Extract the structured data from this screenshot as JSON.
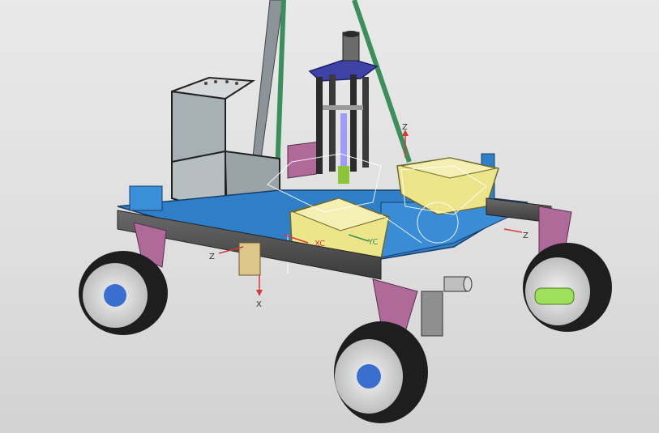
{
  "viewport": {
    "background_top": "#e9e9e9",
    "background_bottom": "#d2d2d2"
  },
  "axes": {
    "z_top": "Z",
    "z_right": "Z",
    "z_left": "Z",
    "x_bottom": "X",
    "xc": "XC",
    "yc": "YC"
  },
  "colors": {
    "chassis_blue": "#2f7fc8",
    "frame_dark": "#4a4a4a",
    "bin_yellow": "#ece58a",
    "panel_gray": "#9aa3a8",
    "mast_green": "#3a8f5a",
    "tire_black": "#1e1e1e",
    "suspension_purple": "#b06a9a",
    "hub_blue": "#3a6fd0",
    "wire_white": "#ffffff",
    "csys_red": "#d23a3a"
  },
  "icons": {
    "wheel": "wheel-icon",
    "coordinate_system": "csys-triad-icon"
  }
}
